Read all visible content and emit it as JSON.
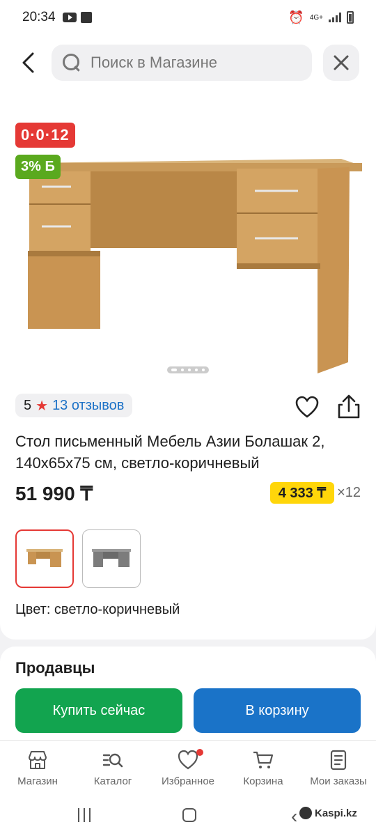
{
  "status_bar": {
    "time": "20:34",
    "network": "4G+"
  },
  "search": {
    "placeholder": "Поиск в Магазине"
  },
  "product": {
    "timer_badge": "0·0·12",
    "bonus_badge": "3% Б",
    "rating": "5",
    "reviews_label": "13 отзывов",
    "title": "Стол письменный Мебель Азии Болашак 2, 140х65х75 см, светло-коричневый",
    "price": "51 990 ₸",
    "installment_price": "4 333 ₸",
    "installment_months": "×12",
    "color_label": "Цвет: светло-коричневый",
    "image_count": 5,
    "active_image": 1,
    "colors": {
      "timer": "#e53935",
      "bonus": "#5aa91e",
      "installment": "#ffd60a"
    }
  },
  "sellers": {
    "title": "Продавцы",
    "buy_now": "Купить сейчас",
    "add_to_cart": "В корзину",
    "colors": {
      "buy": "#12a44f",
      "cart": "#1a73c8"
    }
  },
  "bottom_nav": {
    "items": [
      {
        "label": "Магазин",
        "icon": "store-icon"
      },
      {
        "label": "Каталог",
        "icon": "catalog-search-icon"
      },
      {
        "label": "Избранное",
        "icon": "heart-icon"
      },
      {
        "label": "Корзина",
        "icon": "cart-icon"
      },
      {
        "label": "Мои заказы",
        "icon": "orders-icon"
      }
    ]
  },
  "watermark": "Kaspi.kz"
}
